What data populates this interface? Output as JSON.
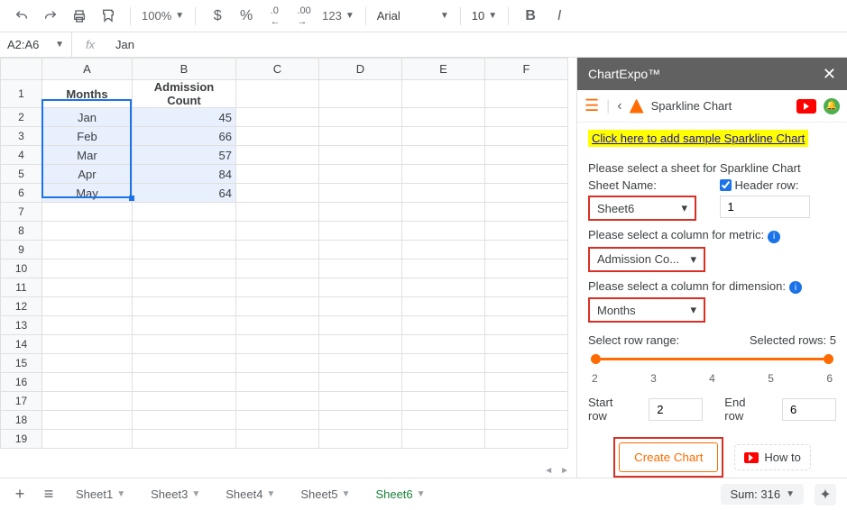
{
  "toolbar": {
    "zoom": "100%",
    "font": "Arial",
    "font_size": "10"
  },
  "fx": {
    "cell_ref": "A2:A6",
    "fx_label": "fx",
    "value": "Jan"
  },
  "chart_data": {
    "type": "table",
    "headers": [
      "Months",
      "Admission Count"
    ],
    "rows": [
      {
        "month": "Jan",
        "count": 45
      },
      {
        "month": "Feb",
        "count": 66
      },
      {
        "month": "Mar",
        "count": 57
      },
      {
        "month": "Apr",
        "count": 84
      },
      {
        "month": "May",
        "count": 64
      }
    ]
  },
  "columns": [
    "A",
    "B",
    "C",
    "D",
    "E",
    "F"
  ],
  "sheet_tabs": [
    "Sheet1",
    "Sheet3",
    "Sheet4",
    "Sheet5",
    "Sheet6"
  ],
  "active_sheet": "Sheet6",
  "sidebar": {
    "header": "ChartExpo™",
    "chart_type": "Sparkline Chart",
    "sample_link": "Click here to add sample Sparkline Chart",
    "sheet_prompt": "Please select a sheet for Sparkline Chart",
    "sheet_name_label": "Sheet Name:",
    "header_row_label": "Header row:",
    "sheet_name_value": "Sheet6",
    "header_row_checked": true,
    "header_row_value": "1",
    "metric_prompt": "Please select a column for metric:",
    "metric_value": "Admission Co...",
    "dimension_prompt": "Please select a column for dimension:",
    "dimension_value": "Months",
    "range_label": "Select row range:",
    "selected_rows": "Selected rows: 5",
    "ticks": [
      "2",
      "3",
      "4",
      "5",
      "6"
    ],
    "start_row_label": "Start row",
    "start_row_value": "2",
    "end_row_label": "End row",
    "end_row_value": "6",
    "create_btn": "Create Chart",
    "howto_btn": "How to"
  },
  "bottom": {
    "sum_label": "Sum: 316"
  }
}
